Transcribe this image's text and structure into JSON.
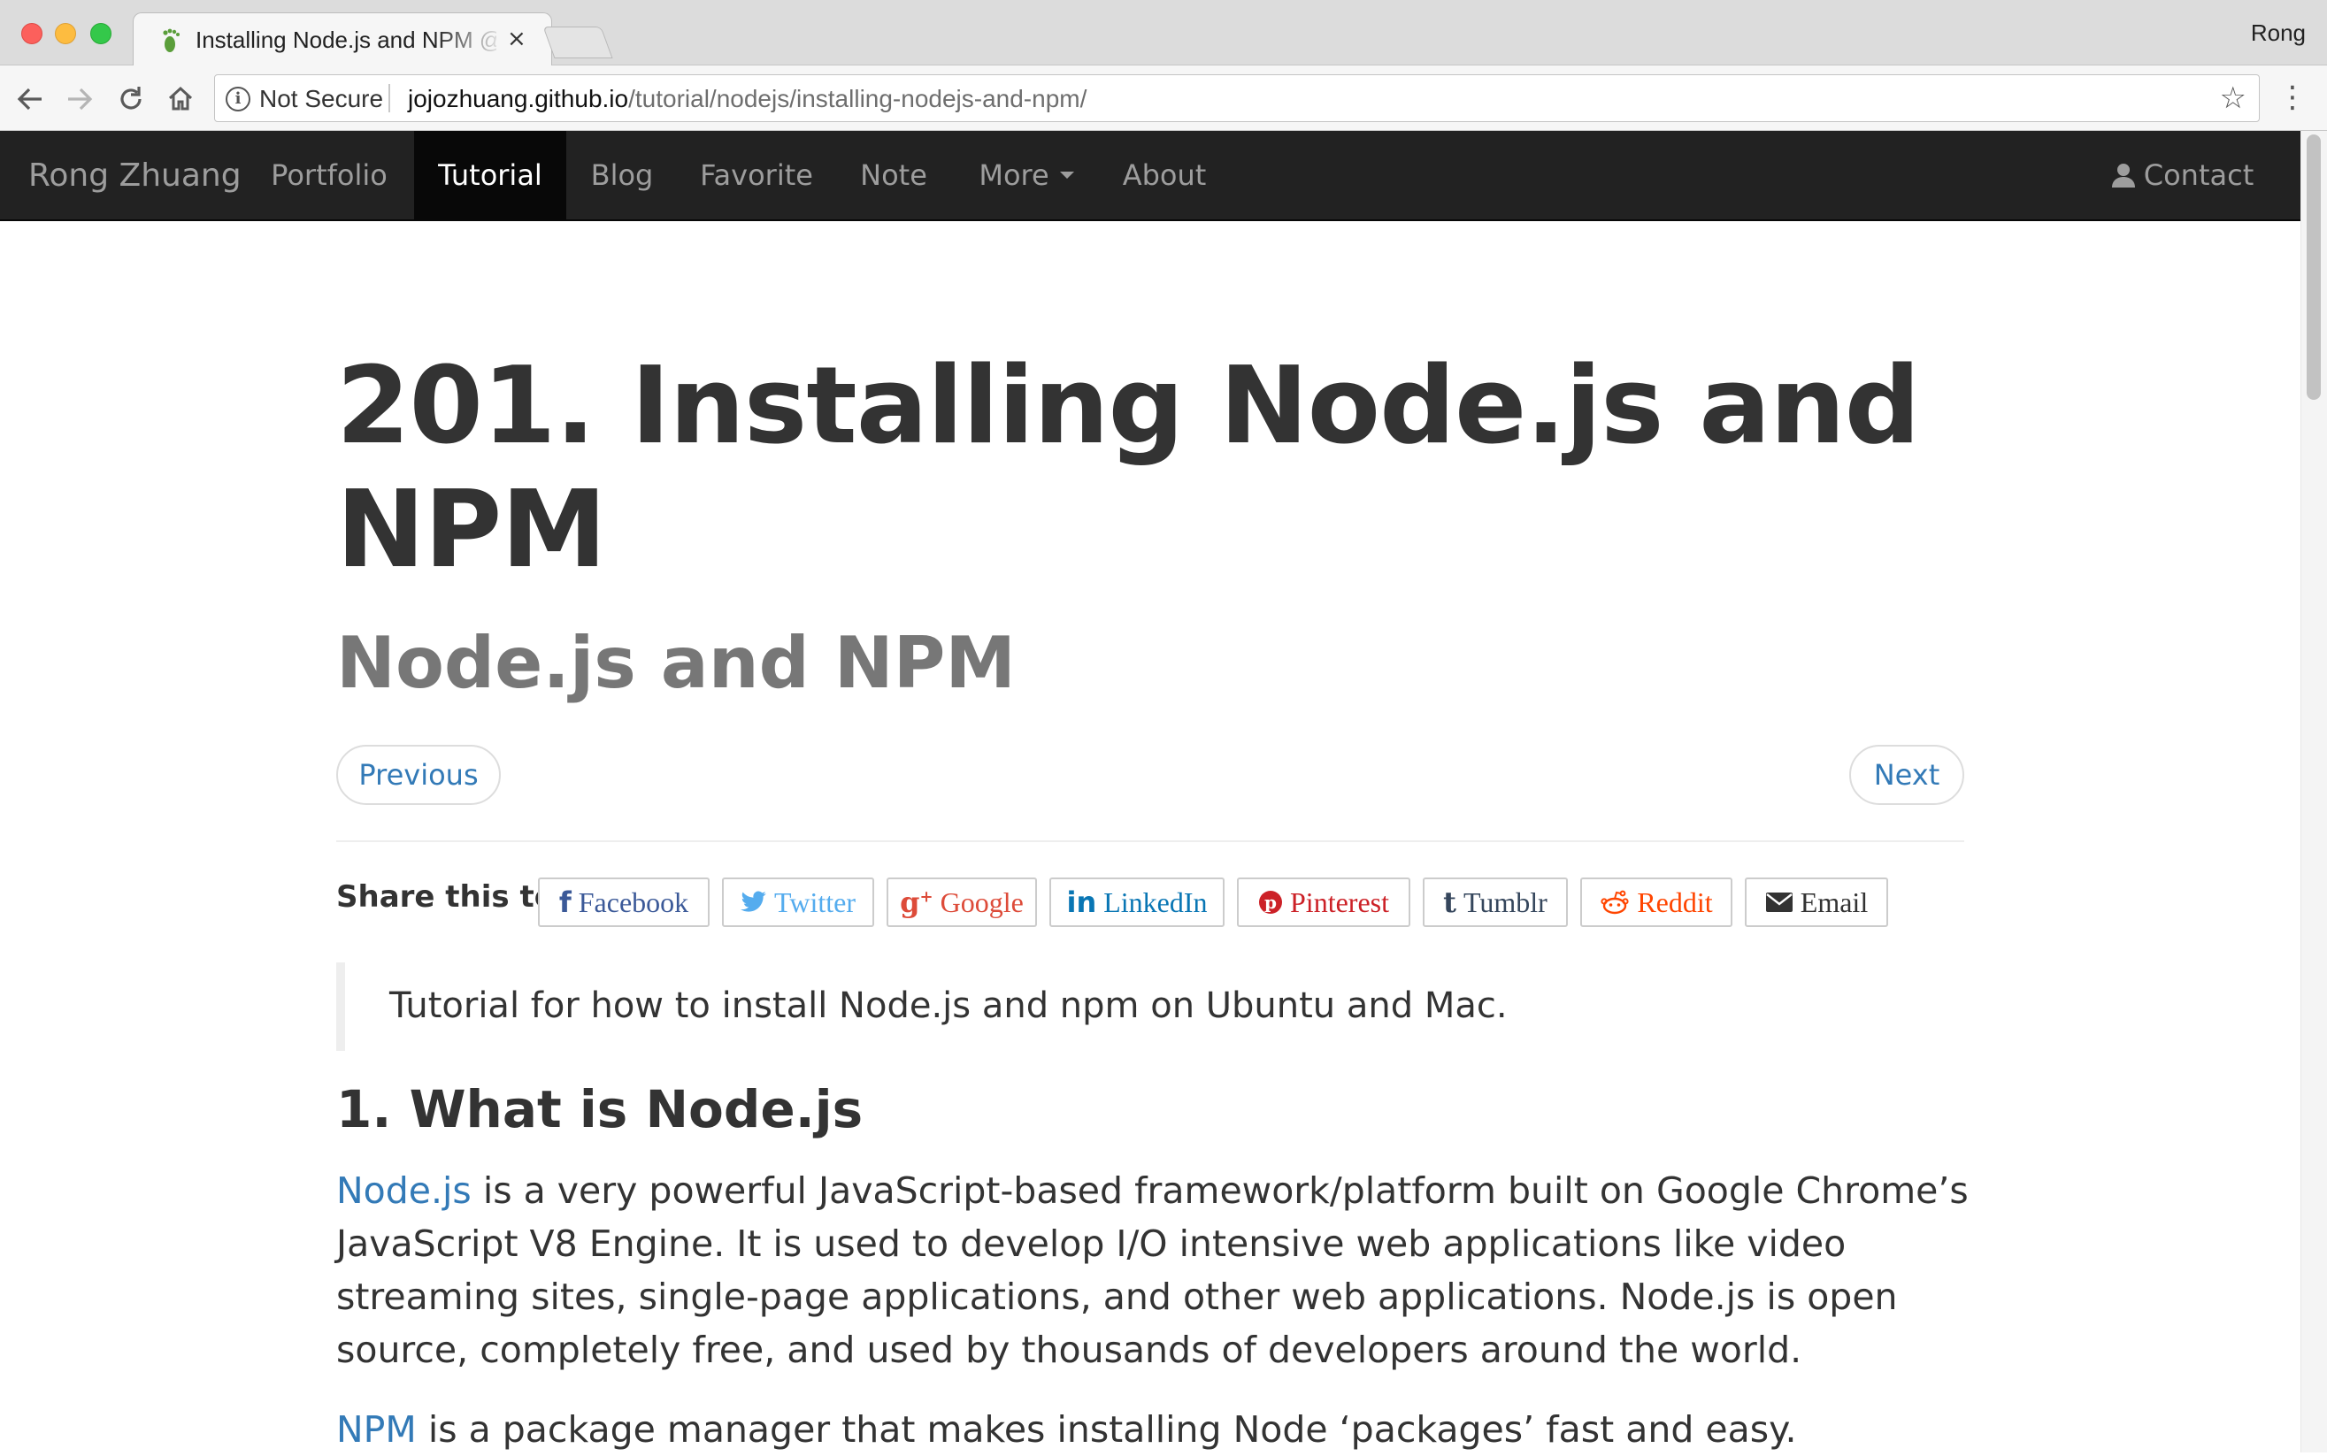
{
  "browser": {
    "tab_title": "Installing Node.js and NPM @ R",
    "tab_close": "×",
    "profile_name": "Rong",
    "security_label": "Not Secure",
    "url_host": "jojozhuang.github.io",
    "url_path": "/tutorial/nodejs/installing-nodejs-and-npm/",
    "icons": {
      "back": "back-arrow-icon",
      "forward": "forward-arrow-icon",
      "reload": "reload-icon",
      "home": "home-icon",
      "info": "info-icon",
      "bookmark": "star-icon",
      "menu": "three-dots-icon"
    }
  },
  "navbar": {
    "brand": "Rong Zhuang",
    "items": [
      {
        "label": "Portfolio"
      },
      {
        "label": "Tutorial",
        "active": true
      },
      {
        "label": "Blog"
      },
      {
        "label": "Favorite"
      },
      {
        "label": "Note"
      },
      {
        "label": "More"
      },
      {
        "label": "About"
      }
    ],
    "contact": "Contact",
    "colors": {
      "background": "#222222",
      "active_background": "#080808",
      "text": "#9d9d9d",
      "active_text": "#ffffff"
    }
  },
  "post": {
    "title": "201. Installing Node.js and NPM",
    "subtitle": "Node.js and NPM",
    "previous_label": "Previous",
    "next_label": "Next",
    "share_label": "Share this to:",
    "share_buttons": [
      {
        "label": "Facebook",
        "icon": "facebook-icon",
        "color": "#3b5998"
      },
      {
        "label": "Twitter",
        "icon": "twitter-icon",
        "color": "#55acee"
      },
      {
        "label": "Google",
        "icon": "google-plus-icon",
        "color": "#dd4b39"
      },
      {
        "label": "LinkedIn",
        "icon": "linkedin-icon",
        "color": "#0976b4"
      },
      {
        "label": "Pinterest",
        "icon": "pinterest-icon",
        "color": "#cc2127"
      },
      {
        "label": "Tumblr",
        "icon": "tumblr-icon",
        "color": "#35465c"
      },
      {
        "label": "Reddit",
        "icon": "reddit-icon",
        "color": "#ff4500"
      },
      {
        "label": "Email",
        "icon": "envelope-icon",
        "color": "#333333"
      }
    ],
    "excerpt": "Tutorial for how to install Node.js and npm on Ubuntu and Mac.",
    "section_heading": "1. What is Node.js",
    "para1_link": "Node.js",
    "para1_text": " is a very powerful JavaScript-based framework/platform built on Google Chrome’s JavaScript V8 Engine. It is used to develop I/O intensive web applications like video streaming sites, single-page applications, and other web applications. Node.js is open source, completely free, and used by thousands of developers around the world.",
    "para2_link": "NPM",
    "para2_text": " is a package manager that makes installing Node ‘packages’ fast and easy.",
    "link_color": "#337ab7"
  }
}
